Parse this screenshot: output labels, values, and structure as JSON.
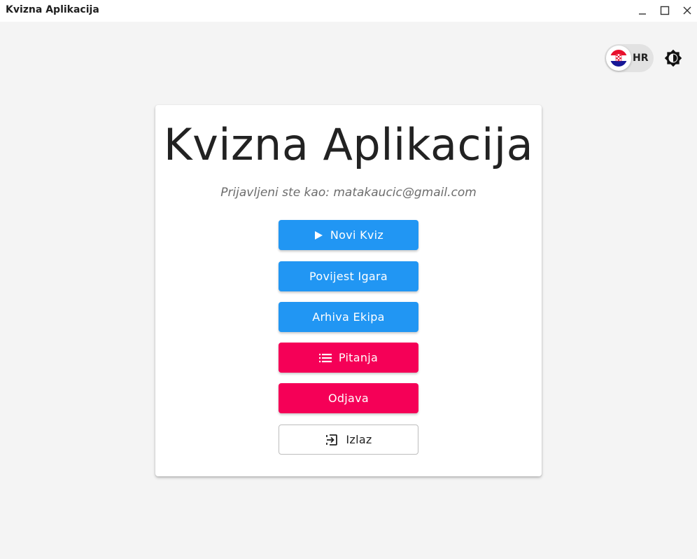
{
  "window": {
    "title": "Kvizna Aplikacija"
  },
  "header": {
    "language_code": "HR",
    "flag_icon": "croatia-flag-icon",
    "theme_icon": "brightness-icon"
  },
  "main": {
    "heading": "Kvizna Aplikacija",
    "subtitle": "Prijavljeni ste kao: matakaucic@gmail.com",
    "buttons": [
      {
        "label": "Novi Kviz",
        "icon": "play-icon",
        "color": "#2196f3"
      },
      {
        "label": "Povijest Igara",
        "color": "#2196f3"
      },
      {
        "label": "Arhiva Ekipa",
        "color": "#2196f3"
      },
      {
        "label": "Pitanja",
        "icon": "list-icon",
        "color": "#f50057"
      },
      {
        "label": "Odjava",
        "color": "#f50057"
      },
      {
        "label": "Izlaz",
        "icon": "exit-icon",
        "color": "#ffffff"
      }
    ]
  },
  "colors": {
    "primary": "#2196f3",
    "secondary": "#f50057",
    "background": "#f4f4f4"
  }
}
